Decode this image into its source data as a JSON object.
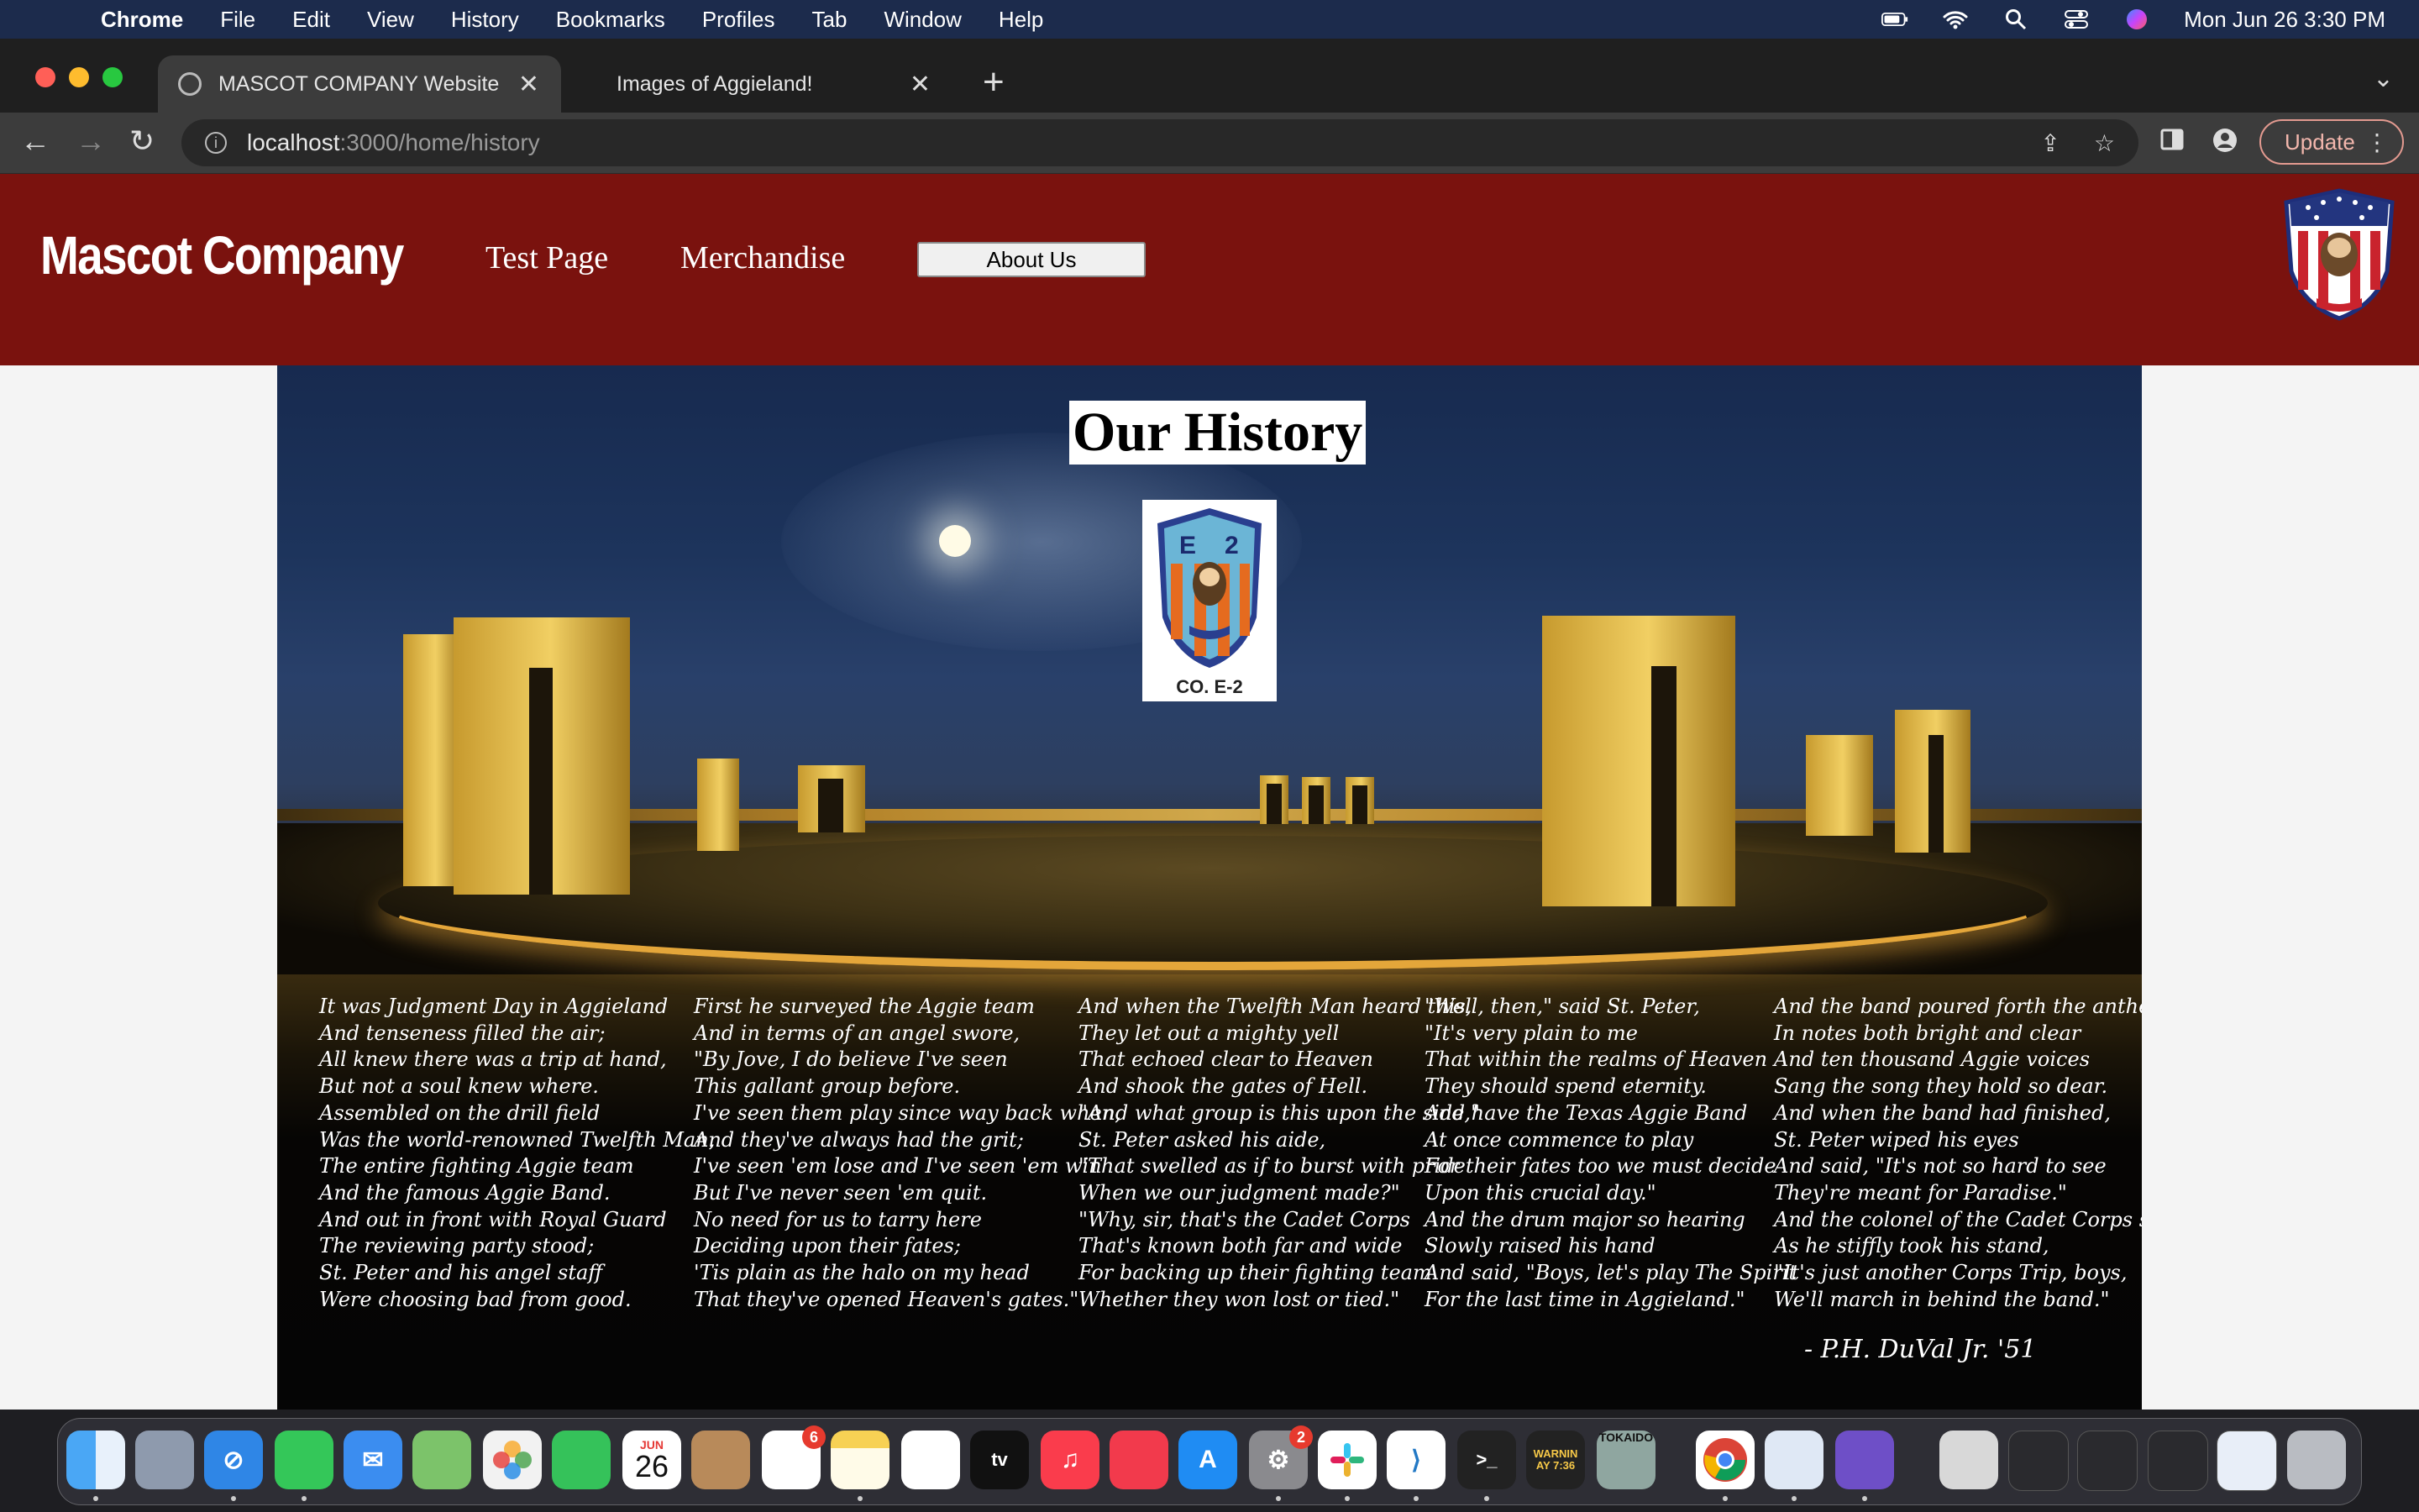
{
  "menubar": {
    "app_name": "Chrome",
    "menus": [
      "File",
      "Edit",
      "View",
      "History",
      "Bookmarks",
      "Profiles",
      "Tab",
      "Window",
      "Help"
    ],
    "clock": "Mon Jun 26  3:30 PM"
  },
  "tabs": [
    {
      "title": "MASCOT COMPANY Website",
      "active": true
    },
    {
      "title": "Images of Aggieland!",
      "active": false
    }
  ],
  "address_bar": {
    "host": "localhost",
    "path": ":3000/home/history"
  },
  "toolbar": {
    "update_label": "Update"
  },
  "site": {
    "brand": "Mascot Company",
    "nav": [
      "Test Page",
      "Merchandise"
    ],
    "about_button": "About Us",
    "header_color": "#7a120e"
  },
  "page": {
    "title": "Our History",
    "badge_caption": "CO. E-2",
    "poem_columns": [
      "It was Judgment Day in Aggieland\nAnd tenseness filled the air;\nAll knew there was a trip at hand,\nBut not a soul knew where.\nAssembled on the drill field\nWas the world-renowned Twelfth Man,\nThe entire fighting Aggie team\nAnd the famous Aggie Band.\nAnd out in front with Royal Guard\nThe reviewing party stood;\nSt. Peter and his angel staff\nWere choosing bad from good.",
      "First he surveyed the Aggie team\nAnd in terms of an angel swore,\n\"By Jove, I do believe I've seen\nThis gallant group before.\nI've seen them play since way back when,\nAnd they've always had the grit;\nI've seen 'em lose and I've seen 'em win\nBut I've never seen 'em quit.\nNo need for us to tarry here\nDeciding upon their fates;\n'Tis plain as the halo on my head\nThat they've opened Heaven's gates.\"",
      "And when the Twelfth Man heard this,\nThey let out a mighty yell\nThat echoed clear to Heaven\nAnd shook the gates of Hell.\n\"And what group is this upon the side,\"\nSt. Peter asked his aide,\n\"That swelled as if to burst with pride\nWhen we our judgment made?\"\n\"Why, sir, that's the Cadet Corps\nThat's known both far and wide\nFor backing up their fighting team\nWhether they won lost or tied.\"",
      "\"Well, then,\" said St. Peter,\n\"It's very plain to me\nThat within the realms of Heaven\nThey should spend eternity.\nAnd have the Texas Aggie Band\nAt once commence to play\nFor their fates too we must decide\nUpon this crucial day.\"\nAnd the drum major so hearing\nSlowly raised his hand\nAnd said, \"Boys, let's play The Spirit\nFor the last time in Aggieland.\"",
      "And the band poured forth the anthem,\nIn notes both bright and clear\nAnd ten thousand Aggie voices\nSang the song they hold so dear.\nAnd when the band had finished,\nSt. Peter wiped his eyes\nAnd said, \"It's not so hard to see\nThey're meant for Paradise.\"\nAnd the colonel of the Cadet Corps said\nAs he stiffly took his stand,\n\"It's just another Corps Trip, boys,\nWe'll march in behind the band.\""
    ],
    "signature": "- P.H. DuVal Jr. '51"
  },
  "dock": {
    "calendar_month": "JUN",
    "calendar_day": "26",
    "reminders_badge": "6",
    "settings_badge": "2",
    "console_text": "WARNIN AY 7:36",
    "tokaido_label": "TOKAIDO",
    "apps": [
      "finder-icon",
      "launchpad-icon",
      "safari-icon",
      "messages-icon",
      "mail-icon",
      "maps-icon",
      "photos-icon",
      "facetime-icon",
      "calendar-icon",
      "contacts-icon",
      "reminders-icon",
      "notes-icon",
      "freeform-icon",
      "tv-icon",
      "music-icon",
      "news-icon",
      "app-store-icon",
      "system-settings-icon",
      "slack-icon",
      "vscode-icon",
      "terminal-icon",
      "console-icon",
      "tokaido-icon",
      "chrome-icon",
      "preview-icon",
      "github-desktop-icon"
    ]
  }
}
